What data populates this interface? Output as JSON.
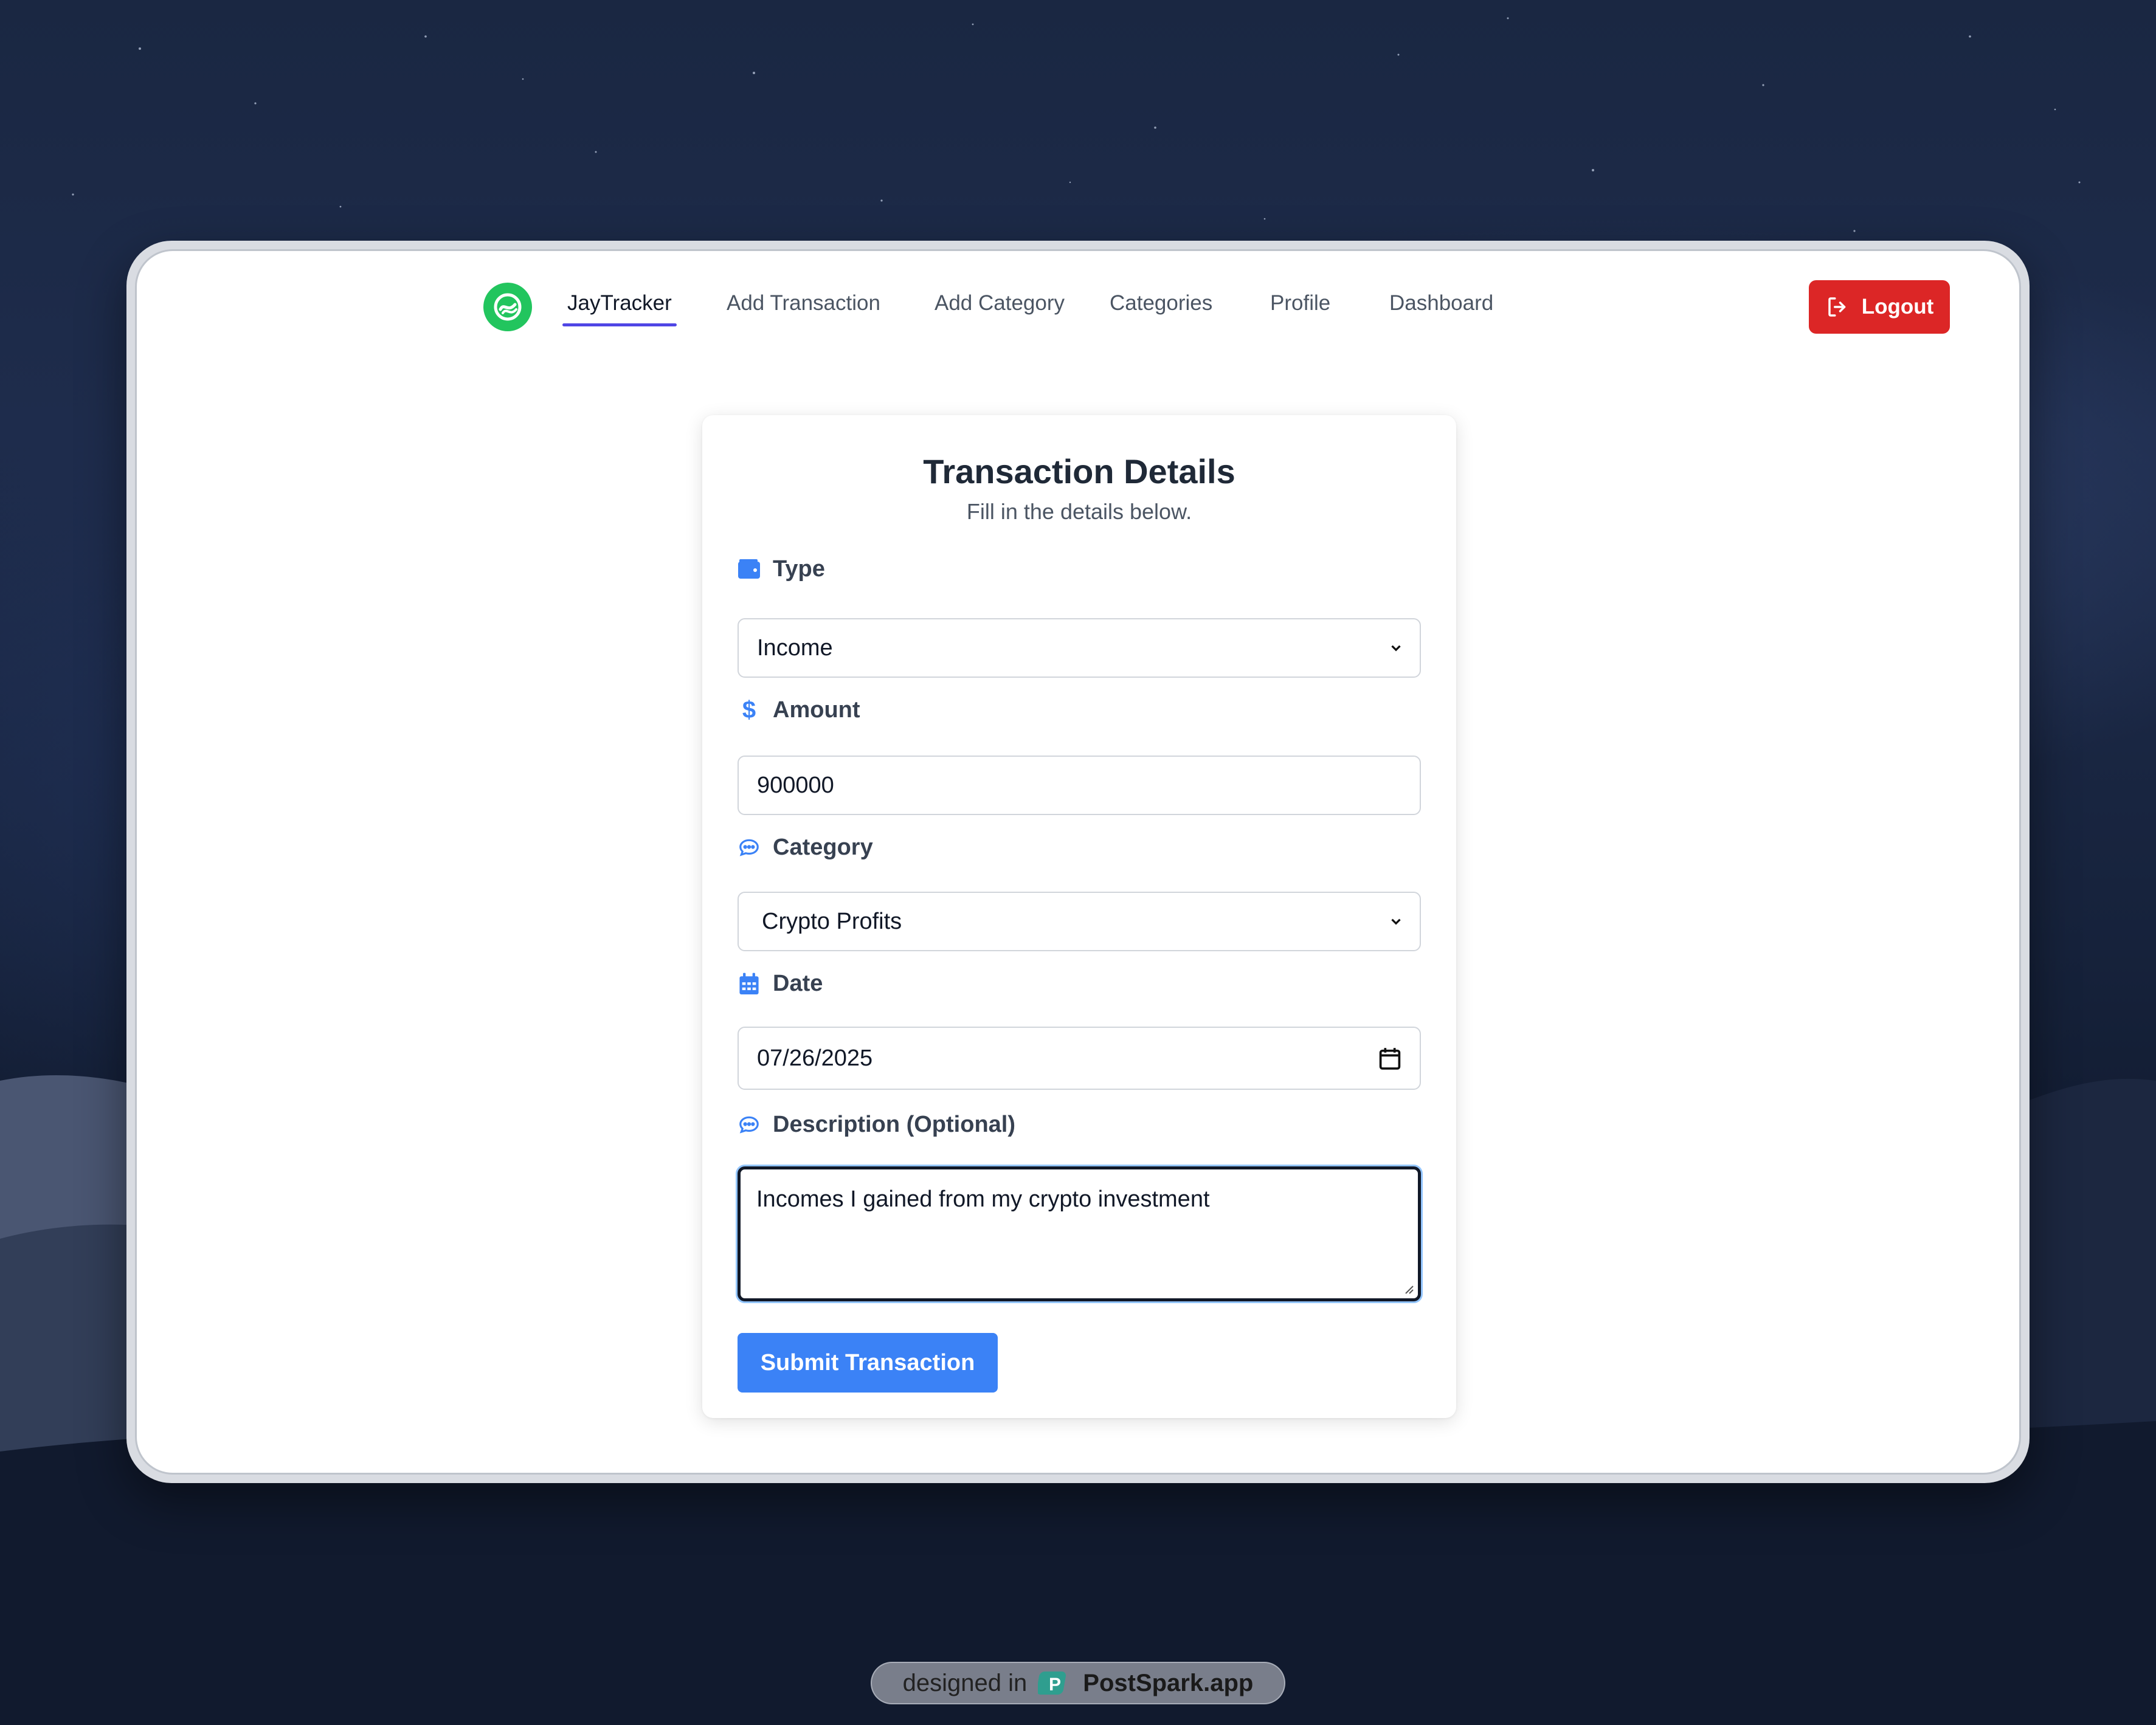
{
  "nav": {
    "brand": "JayTracker",
    "links": [
      {
        "label": "JayTracker",
        "active": true
      },
      {
        "label": "Add Transaction",
        "active": false
      },
      {
        "label": "Add Category",
        "active": false
      },
      {
        "label": "Categories",
        "active": false
      },
      {
        "label": "Profile",
        "active": false
      },
      {
        "label": "Dashboard",
        "active": false
      }
    ],
    "logout_label": "Logout"
  },
  "form": {
    "title": "Transaction Details",
    "subtitle": "Fill in the details below.",
    "type": {
      "label": "Type",
      "value": "Income",
      "icon": "wallet-icon"
    },
    "amount": {
      "label": "Amount",
      "value": "900000",
      "icon": "dollar-icon"
    },
    "category": {
      "label": "Category",
      "value": "Crypto Profits",
      "icon": "comment-icon"
    },
    "date": {
      "label": "Date",
      "value": "07/26/2025",
      "icon": "calendar-icon"
    },
    "description": {
      "label": "Description (Optional)",
      "value": "Incomes I gained from my crypto investment",
      "icon": "comment-icon"
    },
    "submit_label": "Submit Transaction"
  },
  "watermark": {
    "prefix": "designed in",
    "brand": "PostSpark.app"
  },
  "colors": {
    "accent_blue": "#3b82f6",
    "logout_red": "#dc2626",
    "logo_green": "#22c55e",
    "active_underline": "#4f46e5"
  }
}
